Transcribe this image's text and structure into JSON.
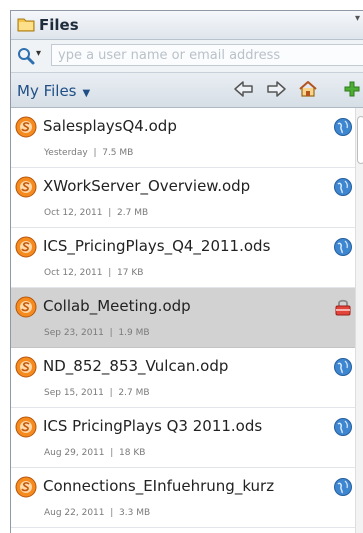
{
  "header": {
    "title": "Files"
  },
  "search": {
    "placeholder": "ype a user name or email address"
  },
  "toolbar": {
    "my_files_label": "My Files"
  },
  "files": [
    {
      "name": "SalesplaysQ4.odp",
      "date": "Yesterday",
      "size": "7.5 MB",
      "status_icon": "globe-icon"
    },
    {
      "name": "XWorkServer_Overview.odp",
      "date": "Oct 12, 2011",
      "size": "2.7 MB",
      "status_icon": "globe-icon"
    },
    {
      "name": "ICS_PricingPlays_Q4_2011.ods",
      "date": "Oct 12, 2011",
      "size": "17 KB",
      "status_icon": "globe-icon"
    },
    {
      "name": "Collab_Meeting.odp",
      "date": "Sep 23, 2011",
      "size": "1.9 MB",
      "status_icon": "lock-icon"
    },
    {
      "name": "ND_852_853_Vulcan.odp",
      "date": "Sep 15, 2011",
      "size": "2.7 MB",
      "status_icon": "globe-icon"
    },
    {
      "name": "ICS PricingPlays Q3 2011.ods",
      "date": "Aug 29, 2011",
      "size": "18 KB",
      "status_icon": "globe-icon"
    },
    {
      "name": "Connections_EInfuehrung_kurz",
      "date": "Aug 22, 2011",
      "size": "3.3 MB",
      "status_icon": "globe-icon"
    }
  ],
  "meta_separator": "|",
  "colors": {
    "accent": "#1f4f86",
    "selected_row": "#d2d2d2",
    "file_icon": "#f58a1f"
  }
}
